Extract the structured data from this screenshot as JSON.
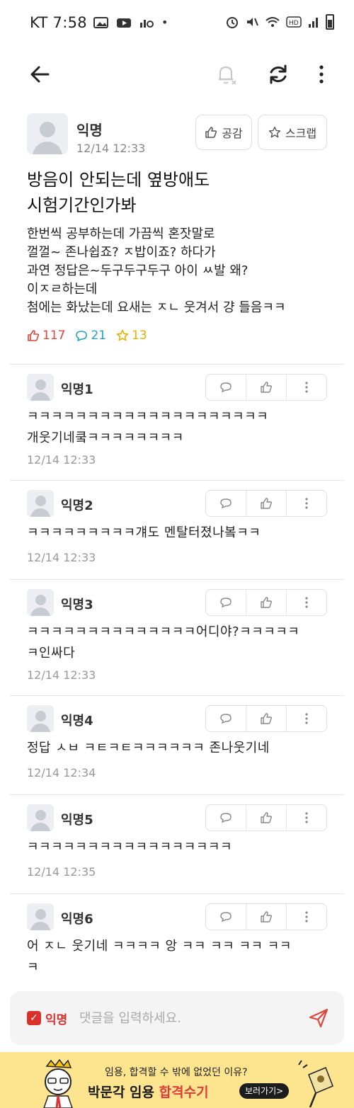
{
  "status_bar": {
    "carrier_time": "KT 7:58",
    "dot": "•"
  },
  "post": {
    "author": "익명",
    "date": "12/14 12:33",
    "like_button": "공감",
    "scrap_button": "스크랩",
    "title_lines": [
      "방음이 안되는데 옆방애도",
      "시험기간인가봐"
    ],
    "body_lines": [
      "한번씩 공부하는데 가끔씩 혼잣말로",
      "껄껄~ 존나쉽죠? ㅈ밥이죠? 하다가",
      "과연 정답은~두구두구두구 아이 ㅆ발 왜?",
      "이ㅈㄹ하는데",
      "첨에는 화났는데 요새는 ㅈㄴ 웃겨서 걍 들음ㅋㅋ"
    ],
    "likes": "117",
    "comments": "21",
    "scraps": "13"
  },
  "comments": [
    {
      "name": "익명1",
      "lines": [
        "ㅋㅋㅋㅋㅋㅋㅋㅋㅋㅋㅋㅋㅋㅋㅋㅋㅋㅋㅋㅋ",
        "개웃기네쿸ㅋㅋㅋㅋㅋㅋㅋㅋ"
      ],
      "time": "12/14 12:33"
    },
    {
      "name": "익명2",
      "lines": [
        "ㅋㅋㅋㅋㅋㅋㅋㅋㅋ걔도 멘탈터졌나봌ㅋㅋ"
      ],
      "time": "12/14 12:33"
    },
    {
      "name": "익명3",
      "lines": [
        "ㅋㅋㅋㅋㅋㅋㅋㅋㅋㅋㅋㅋㅋㅋ어디야?ㅋㅋㅋㅋㅋ",
        "ㅋ인싸다"
      ],
      "time": "12/14 12:33"
    },
    {
      "name": "익명4",
      "lines": [
        "정답 ㅅㅂ ㅋㅌㅋㅌㅋㅋㅋㅋㅋㅋ 존나웃기네"
      ],
      "time": "12/14 12:34"
    },
    {
      "name": "익명5",
      "lines": [
        "ㅋㅋㅋㅋㅋㅋㅋㅋㅋㅋㅋㅋㅋㅋㅋㅋㅋ"
      ],
      "time": "12/14 12:35"
    },
    {
      "name": "익명6",
      "lines": [
        "어 ㅈㄴ 웃기네 ㅋㅋㅋㅋ 앙 ㅋㅋ ㅋㅋ ㅋㅋ ㅋㅋ",
        "ㅋ"
      ],
      "time": ""
    }
  ],
  "input_bar": {
    "anon_label": "익명",
    "placeholder": "댓글을 입력하세요."
  },
  "banner": {
    "line1": "임용, 합격할 수 밖에 없었던 이유?",
    "line2_prefix": "박문각 임용 ",
    "line2_highlight": "합격수기",
    "cta": "보러가기>"
  },
  "colors": {
    "accent_red": "#d9312b",
    "like_red": "#e0453a",
    "comment_blue": "#1ea4c7",
    "scrap_yellow": "#e1b300",
    "banner_bg": "#fde48e"
  }
}
